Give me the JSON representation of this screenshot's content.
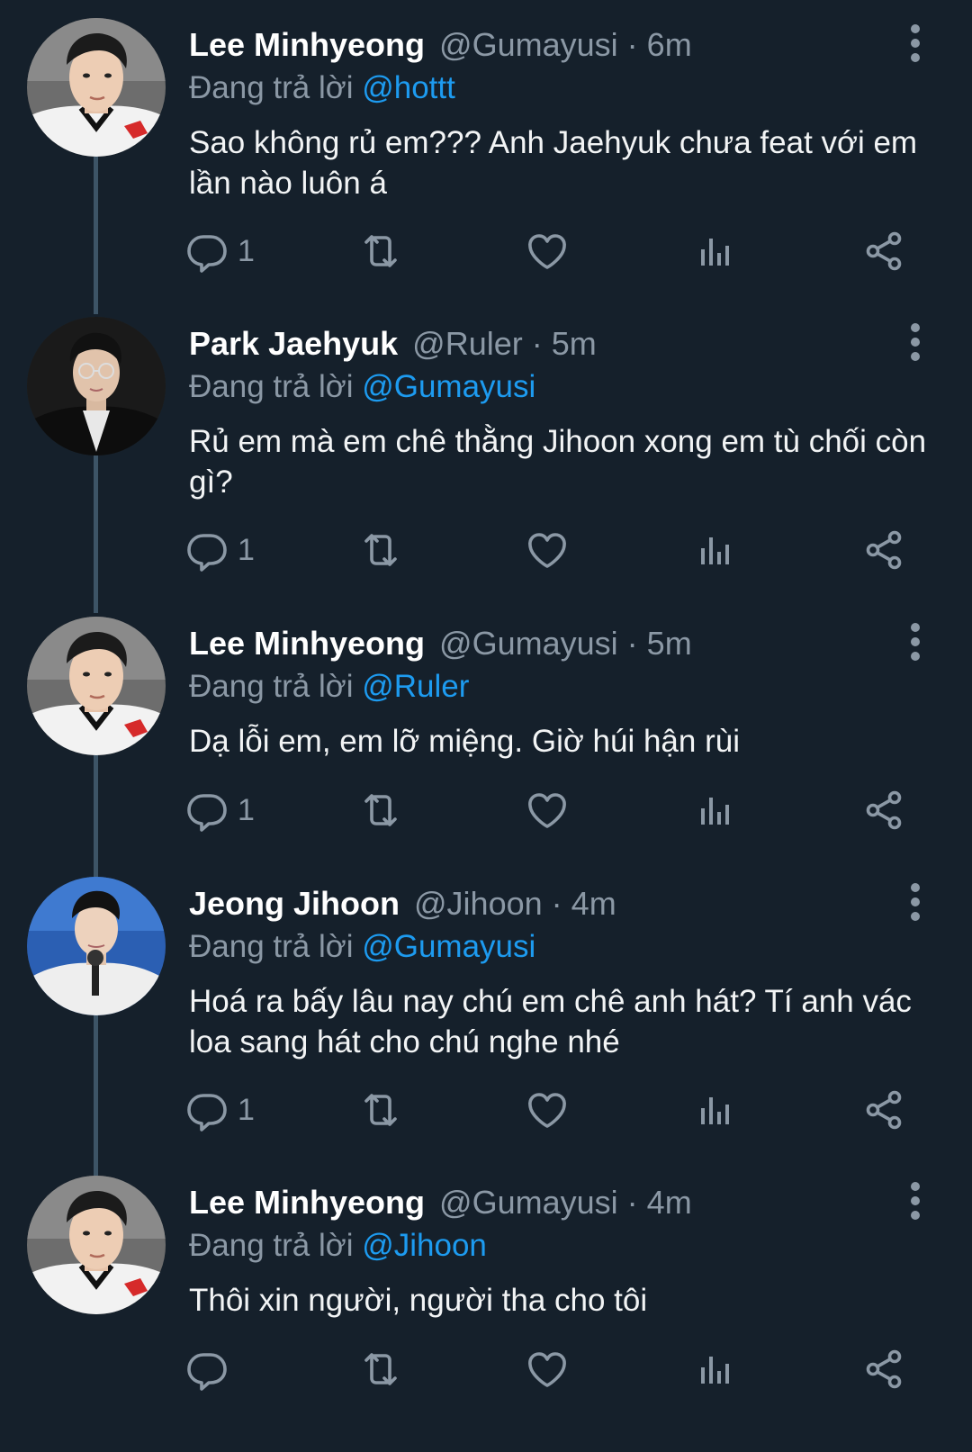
{
  "colors": {
    "background": "#15202b",
    "secondary_text": "#8b98a5",
    "mention": "#1d9bf0",
    "thread_line": "#3d5466"
  },
  "icons": {
    "reply": "speech-bubble-icon",
    "retweet": "retweet-icon",
    "like": "heart-icon",
    "views": "bar-chart-icon",
    "share": "share-icon",
    "more": "vertical-ellipsis-icon"
  },
  "tweets": [
    {
      "name": "Lee Minhyeong",
      "handle": "@Gumayusi",
      "separator": "·",
      "time": "6m",
      "reply_prefix": "Đang trả lời",
      "reply_to": "@hottt",
      "text": "Sao không rủ em??? Anh Jaehyuk chưa feat với em lần nào luôn á",
      "reply_count": "1"
    },
    {
      "name": "Park Jaehyuk",
      "handle": "@Ruler",
      "separator": "·",
      "time": "5m",
      "reply_prefix": "Đang trả lời",
      "reply_to": "@Gumayusi",
      "text": "Rủ em mà em chê thằng Jihoon xong em tù chối còn gì?",
      "reply_count": "1"
    },
    {
      "name": "Lee Minhyeong",
      "handle": "@Gumayusi",
      "separator": "·",
      "time": "5m",
      "reply_prefix": "Đang trả lời",
      "reply_to": "@Ruler",
      "text": "Dạ lỗi em, em lỡ miệng. Giờ húi hận rùi",
      "reply_count": "1"
    },
    {
      "name": "Jeong Jihoon",
      "handle": "@Jihoon",
      "separator": "·",
      "time": "4m",
      "reply_prefix": "Đang trả lời",
      "reply_to": "@Gumayusi",
      "text": "Hoá ra bấy lâu nay chú em chê anh hát? Tí anh vác loa sang hát cho chú nghe nhé",
      "reply_count": "1"
    },
    {
      "name": "Lee Minhyeong",
      "handle": "@Gumayusi",
      "separator": "·",
      "time": "4m",
      "reply_prefix": "Đang trả lời",
      "reply_to": "@Jihoon",
      "text": "Thôi xin người, người tha cho tôi",
      "reply_count": ""
    }
  ]
}
